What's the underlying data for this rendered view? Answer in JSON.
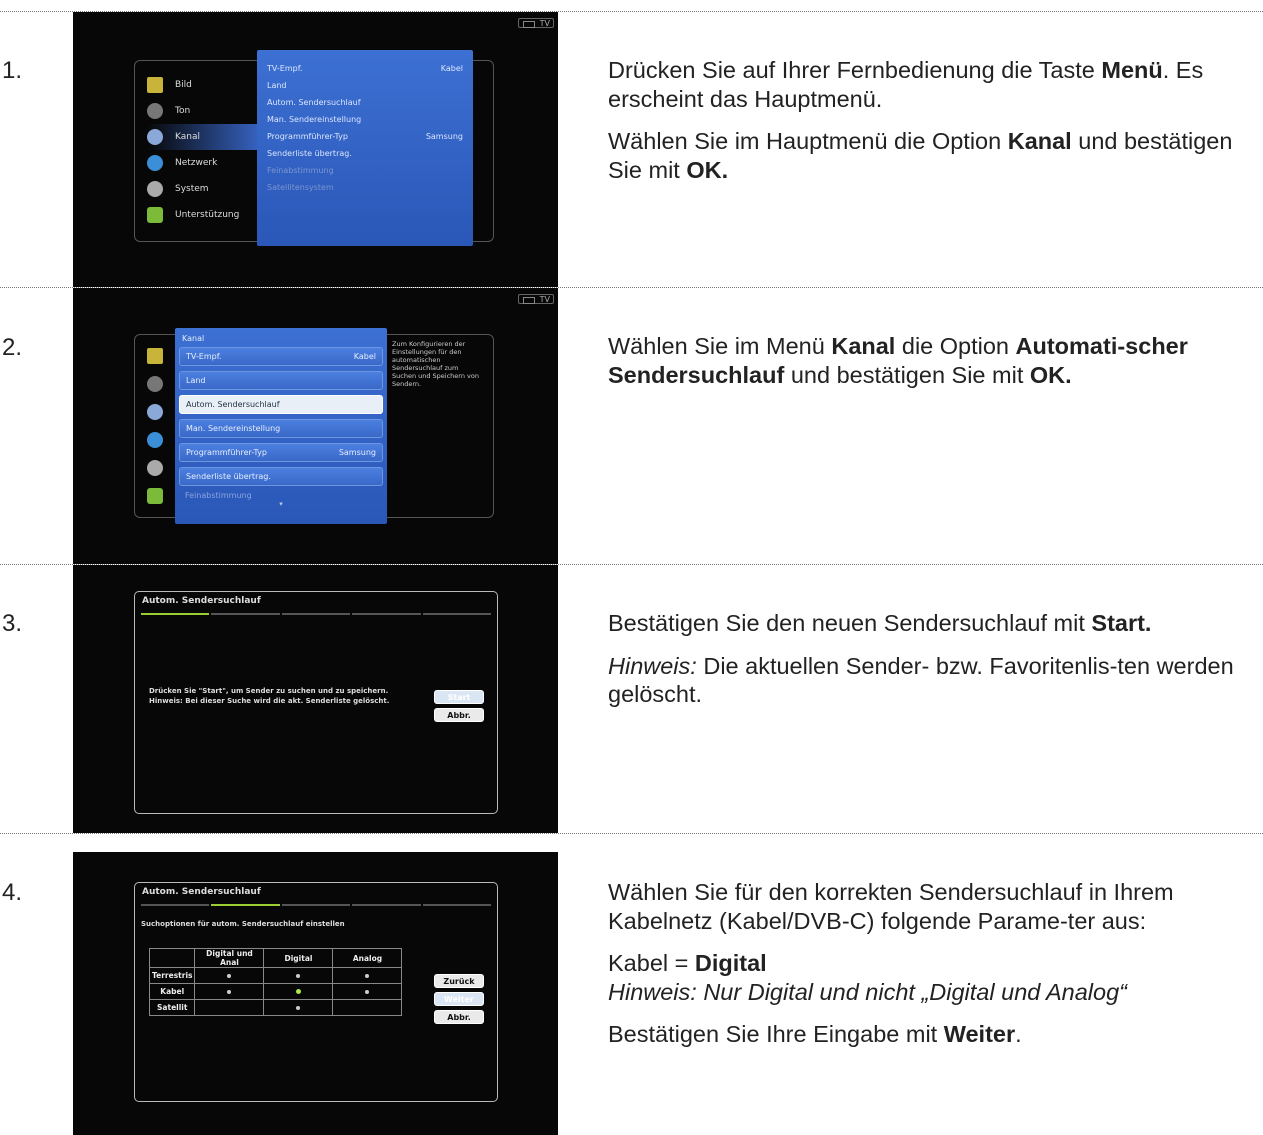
{
  "tv_badge": "TV",
  "steps": [
    {
      "num": "1.",
      "screen": {
        "sidebar": [
          "Bild",
          "Ton",
          "Kanal",
          "Netzwerk",
          "System",
          "Unterstützung"
        ],
        "menu": [
          {
            "label": "TV-Empf.",
            "value": "Kabel"
          },
          {
            "label": "Land",
            "value": ""
          },
          {
            "label": "Autom. Sendersuchlauf",
            "value": ""
          },
          {
            "label": "Man. Sendereinstellung",
            "value": ""
          },
          {
            "label": "Programmführer-Typ",
            "value": "Samsung"
          },
          {
            "label": "Senderliste übertrag.",
            "value": ""
          },
          {
            "label": "Feinabstimmung",
            "value": ""
          },
          {
            "label": "Satellitensystem",
            "value": ""
          }
        ]
      },
      "p1_a": "Drücken Sie auf Ihrer Fernbedienung die Taste ",
      "p1_b": "Menü",
      "p1_c": ". Es erscheint das Hauptmenü.",
      "p2_a": "Wählen Sie im Hauptmenü die Option ",
      "p2_b": "Kanal",
      "p2_c": " und bestätigen Sie mit ",
      "p2_d": "OK."
    },
    {
      "num": "2.",
      "screen": {
        "title": "Kanal",
        "items": [
          {
            "label": "TV-Empf.",
            "value": "Kabel"
          },
          {
            "label": "Land",
            "value": ""
          },
          {
            "label": "Autom. Sendersuchlauf",
            "value": ""
          },
          {
            "label": "Man. Sendereinstellung",
            "value": ""
          },
          {
            "label": "Programmführer-Typ",
            "value": "Samsung"
          },
          {
            "label": "Senderliste übertrag.",
            "value": ""
          }
        ],
        "dim_item": "Feinabstimmung",
        "help": "Zum Konfigurieren der Einstellungen für den automatischen Sendersuchlauf zum Suchen und Speichern von Sendern."
      },
      "p1_a": "Wählen Sie im Menü ",
      "p1_b": "Kanal",
      "p1_c": " die Option ",
      "p1_d": "Automati-scher Sendersuchlauf",
      "p1_e": " und bestätigen Sie mit ",
      "p1_f": "OK."
    },
    {
      "num": "3.",
      "screen": {
        "title": "Autom. Sendersuchlauf",
        "msg1": "Drücken Sie \"Start\", um Sender zu suchen und zu speichern.",
        "msg2": "Hinweis: Bei dieser Suche wird die akt. Senderliste gelöscht.",
        "btn_start": "Start",
        "btn_cancel": "Abbr."
      },
      "p1_a": "Bestätigen Sie den neuen Sendersuchlauf mit ",
      "p1_b": "Start.",
      "p2_a": "Hinweis:",
      "p2_b": " Die aktuellen Sender- bzw. Favoritenlis-ten werden gelöscht."
    },
    {
      "num": "4.",
      "screen": {
        "title": "Autom. Sendersuchlauf",
        "subtitle": "Suchoptionen für autom. Sendersuchlauf einstellen",
        "cols": [
          "Digital und Anal",
          "Digital",
          "Analog"
        ],
        "rows": [
          "Terrestris",
          "Kabel",
          "Satellit"
        ],
        "btn_back": "Zurück",
        "btn_next": "Weiter",
        "btn_cancel": "Abbr."
      },
      "p1": "Wählen Sie für den korrekten Sendersuchlauf in Ihrem Kabelnetz (Kabel/DVB-C) folgende Parame-ter aus:",
      "p2_a": "Kabel = ",
      "p2_b": "Digital",
      "p2_c": "Hinweis: Nur Digital und nicht „Digital und Analog“",
      "p3_a": "Bestätigen Sie Ihre Eingabe mit ",
      "p3_b": "Weiter",
      "p3_c": "."
    }
  ]
}
